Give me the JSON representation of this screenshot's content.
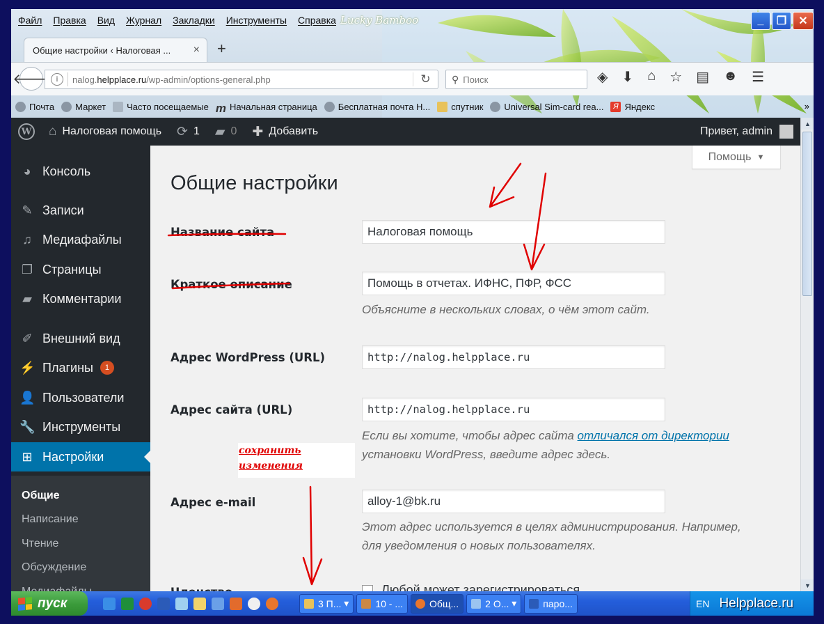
{
  "browser": {
    "menu": [
      "Файл",
      "Правка",
      "Вид",
      "Журнал",
      "Закладки",
      "Инструменты",
      "Справка"
    ],
    "theme_name": "Lucky Bamboo",
    "tab_title": "Общие настройки ‹ Налоговая ...",
    "tab_close": "×",
    "new_tab": "+",
    "url_prefix": "nalog.",
    "url_domain": "helpplace.ru",
    "url_path": "/wp-admin/options-general.php",
    "search_placeholder": "Поиск",
    "bookmarks": [
      "Почта",
      "Маркет",
      "Часто посещаемые",
      "Начальная страница",
      "Бесплатная почта Н...",
      "спутник",
      "Universal Sim-card rea...",
      "Яндекс"
    ],
    "bookmarks_more": "»"
  },
  "adminbar": {
    "site_name": "Налоговая помощь",
    "updates_count": "1",
    "comments_count": "0",
    "add_new": "Добавить",
    "greeting": "Привет, admin"
  },
  "sidebar": {
    "items": [
      {
        "label": "Консоль",
        "icon": "dashboard-icon"
      },
      {
        "label": "Записи",
        "icon": "pin-icon"
      },
      {
        "label": "Медиафайлы",
        "icon": "media-icon"
      },
      {
        "label": "Страницы",
        "icon": "pages-icon"
      },
      {
        "label": "Комментарии",
        "icon": "comment-icon"
      },
      {
        "label": "Внешний вид",
        "icon": "brush-icon"
      },
      {
        "label": "Плагины",
        "icon": "plugin-icon",
        "badge": "1"
      },
      {
        "label": "Пользователи",
        "icon": "users-icon"
      },
      {
        "label": "Инструменты",
        "icon": "wrench-icon"
      },
      {
        "label": "Настройки",
        "icon": "settings-icon",
        "active": true
      }
    ],
    "submenu": [
      "Общие",
      "Написание",
      "Чтение",
      "Обсуждение",
      "Медиафайлы"
    ]
  },
  "main": {
    "help_label": "Помощь",
    "title": "Общие настройки",
    "fields": {
      "site_title": {
        "label": "Название сайта",
        "value": "Налоговая помощь"
      },
      "tagline": {
        "label": "Краткое описание",
        "value": "Помощь в отчетах. ИФНС, ПФР, ФСС",
        "desc": "Объясните в нескольких словах, о чём этот сайт."
      },
      "wp_url": {
        "label": "Адрес WordPress (URL)",
        "value": "http://nalog.helpplace.ru"
      },
      "site_url": {
        "label": "Адрес сайта (URL)",
        "value": "http://nalog.helpplace.ru",
        "desc_before": "Если вы хотите, чтобы адрес сайта ",
        "desc_link": "отличался от директории",
        "desc_after": "установки WordPress, введите адрес здесь."
      },
      "email": {
        "label": "Адрес e-mail",
        "value": "alloy-1@bk.ru",
        "desc_line1": "Этот адрес используется в целях администрирования. Например,",
        "desc_line2": "для уведомления о новых пользователях."
      },
      "membership": {
        "label": "Членство",
        "checkbox_label": "Любой может зарегистрироваться"
      }
    },
    "annotation": [
      "сохранить",
      "изменения"
    ]
  },
  "taskbar": {
    "start": "пуск",
    "tasks": [
      "3 П...",
      "10 - ...",
      "Общ...",
      "2 О...",
      "паро..."
    ],
    "lang": "EN",
    "watermark": "Helpplace.ru"
  },
  "colors": {
    "wp_dark": "#23282d",
    "wp_blue": "#0073aa",
    "annotation_red": "#e00000"
  }
}
